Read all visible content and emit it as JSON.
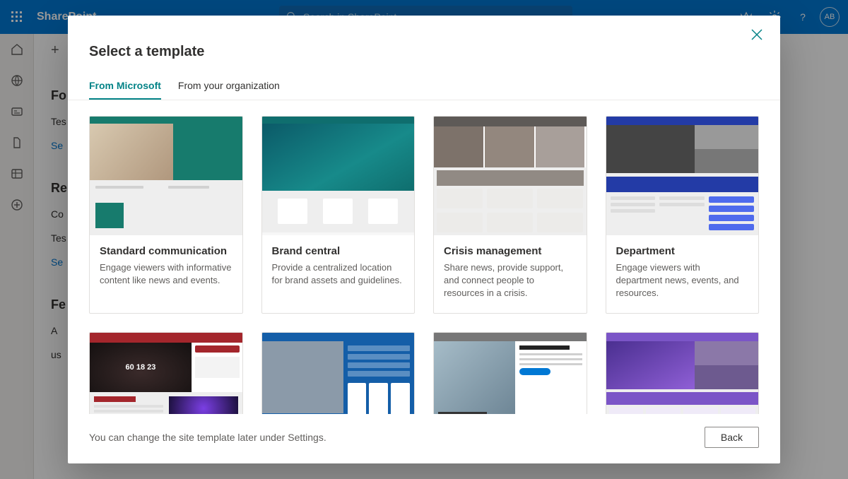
{
  "header": {
    "brand": "SharePoint",
    "search_placeholder": "Search in SharePoint",
    "avatar_initials": "AB"
  },
  "background": {
    "plus_label": "+",
    "sections": [
      {
        "heading": "Fo",
        "items": [
          {
            "text": "Tes",
            "link": false
          },
          {
            "text": "Se",
            "link": true
          }
        ]
      },
      {
        "heading": "Re",
        "items": [
          {
            "text": "Co",
            "link": false
          },
          {
            "text": "Tes",
            "link": false
          },
          {
            "text": "Se",
            "link": true
          }
        ]
      },
      {
        "heading": "Fe",
        "items": [
          {
            "text": "A",
            "link": false
          },
          {
            "text": "us",
            "link": false
          }
        ]
      }
    ]
  },
  "dialog": {
    "title": "Select a template",
    "tabs": [
      {
        "label": "From Microsoft",
        "active": true
      },
      {
        "label": "From your organization",
        "active": false
      }
    ],
    "templates": [
      {
        "id": "standard-communication",
        "title": "Standard communication",
        "desc": "Engage viewers with informative content like news and events.",
        "thumb": "std"
      },
      {
        "id": "brand-central",
        "title": "Brand central",
        "desc": "Provide a centralized location for brand assets and guidelines.",
        "thumb": "brand"
      },
      {
        "id": "crisis-management",
        "title": "Crisis management",
        "desc": "Share news, provide support, and connect people to resources in a crisis.",
        "thumb": "crisis"
      },
      {
        "id": "department",
        "title": "Department",
        "desc": "Engage viewers with department news, events, and resources.",
        "thumb": "dept"
      },
      {
        "id": "event",
        "title": "",
        "desc": "",
        "thumb": "event"
      },
      {
        "id": "human-resources",
        "title": "",
        "desc": "",
        "thumb": "hr"
      },
      {
        "id": "leadership",
        "title": "",
        "desc": "",
        "thumb": "lead"
      },
      {
        "id": "learning",
        "title": "",
        "desc": "",
        "thumb": "learn"
      }
    ],
    "footer_note": "You can change the site template later under Settings.",
    "back_label": "Back",
    "event_counter": "60 18 23"
  }
}
